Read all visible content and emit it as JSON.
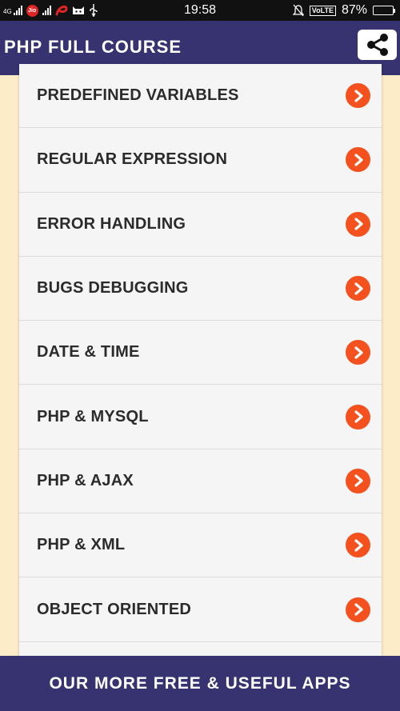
{
  "status_bar": {
    "network": "4G",
    "carrier_icon": "Jio",
    "time": "19:58",
    "volte": "VoLTE",
    "battery": "87%",
    "battery_level": 0.87
  },
  "app": {
    "title": "PHP FULL COURSE",
    "share_icon": "share-icon"
  },
  "topics": [
    {
      "label": "PREDEFINED VARIABLES"
    },
    {
      "label": "REGULAR EXPRESSION"
    },
    {
      "label": "ERROR HANDLING"
    },
    {
      "label": "BUGS DEBUGGING"
    },
    {
      "label": "DATE & TIME"
    },
    {
      "label": "PHP & MYSQL"
    },
    {
      "label": "PHP & AJAX"
    },
    {
      "label": "PHP & XML"
    },
    {
      "label": "OBJECT ORIENTED"
    }
  ],
  "bottom_bar": {
    "label": "OUR MORE FREE & USEFUL APPS"
  },
  "colors": {
    "app_bar": "#373370",
    "background": "#fdecc8",
    "accent": "#f4511e",
    "card": "#f5f5f5"
  }
}
